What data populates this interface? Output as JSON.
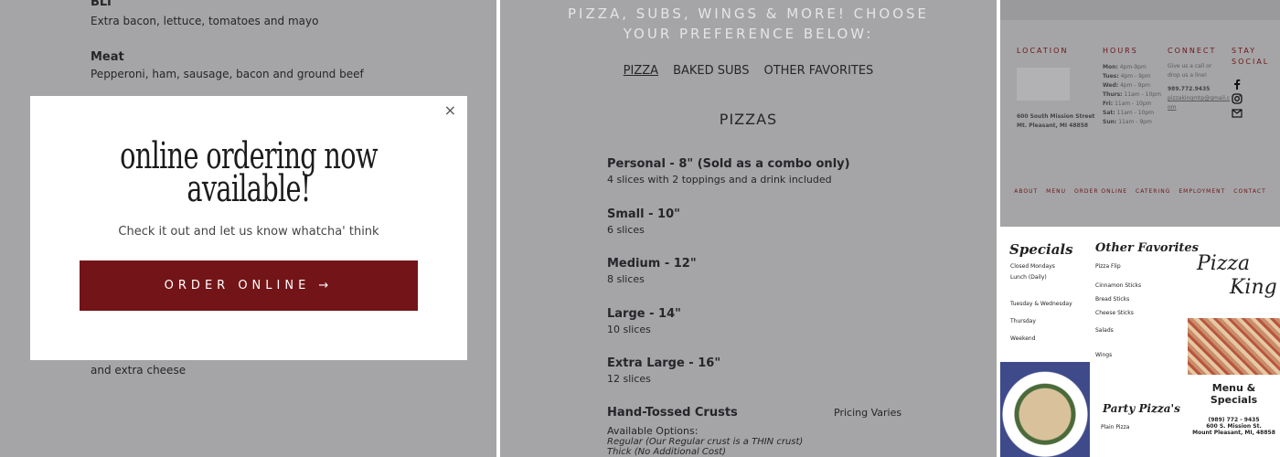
{
  "left": {
    "items": [
      {
        "title": "BLT",
        "desc": "Extra bacon, lettuce, tomatoes and mayo"
      },
      {
        "title": "Meat",
        "desc": "Pepperoni, ham, sausage, bacon and ground beef"
      }
    ],
    "hidden_fragment_1": "and extra cheese",
    "modal": {
      "close": "×",
      "headline_line1": "online ordering now",
      "headline_line2": "available!",
      "subtext": "Check it out and let us know whatcha' think",
      "button": "ORDER ONLINE →"
    }
  },
  "middle": {
    "heading_line1": "PIZZA, SUBS, WINGS & MORE! CHOOSE",
    "heading_line2": "YOUR PREFERENCE BELOW:",
    "tabs": [
      "PIZZA",
      "BAKED SUBS",
      "OTHER FAVORITES"
    ],
    "section_title": "PIZZAS",
    "items": [
      {
        "title": "Personal - 8\" (Sold as a combo only)",
        "desc": "4 slices with 2 toppings and a drink included"
      },
      {
        "title": "Small - 10\"",
        "desc": "6 slices"
      },
      {
        "title": "Medium - 12\"",
        "desc": "8 slices"
      },
      {
        "title": "Large - 14\"",
        "desc": "10 slices"
      },
      {
        "title": "Extra Large - 16\"",
        "desc": "12 slices"
      }
    ],
    "crusts": {
      "title": "Hand-Tossed Crusts",
      "price": "Pricing Varies",
      "available": "Available Options:",
      "regular": "Regular (Our Regular crust is a THIN crust)",
      "thick": "Thick (No Additional Cost)"
    }
  },
  "footer": {
    "location_h": "LOCATION",
    "address1": "600 South Mission Street",
    "address2": "Mt. Pleasant, MI 48858",
    "hours_h": "HOURS",
    "hours": [
      {
        "day": "Mon:",
        "time": "4pm-9pm"
      },
      {
        "day": "Tues:",
        "time": "4pm - 9pm"
      },
      {
        "day": "Wed:",
        "time": "4pm - 9pm"
      },
      {
        "day": "Thurs:",
        "time": "11am - 10pm"
      },
      {
        "day": "Fri:",
        "time": "11am - 10pm"
      },
      {
        "day": "Sat:",
        "time": "11am - 10pm"
      },
      {
        "day": "Sun:",
        "time": "11am - 9pm"
      }
    ],
    "connect_h": "CONNECT",
    "connect_text": "Give us a call or drop us a line!",
    "phone": "989.772.9435",
    "email1": "pizzakingmtp@gmail.c",
    "email2": "om",
    "social_h1": "STAY",
    "social_h2": "SOCIAL",
    "links": [
      "ABOUT",
      "MENU",
      "ORDER ONLINE",
      "CATERING",
      "EMPLOYMENT",
      "CONTACT"
    ]
  },
  "flyer": {
    "specials_h": "Specials",
    "specials": [
      "Closed Mondays",
      "Lunch (Daily)",
      "Tuesday & Wednesday",
      "Thursday",
      "Weekend"
    ],
    "other_h": "Other Favorites",
    "other": [
      "Pizza Flip",
      "Cinnamon Sticks",
      "Bread Sticks",
      "Cheese Sticks",
      "Salads",
      "Wings"
    ],
    "party_h": "Party Pizza's",
    "party_item": "Plain Pizza",
    "logo1": "Pizza",
    "logo2": "King",
    "menu_title": "Menu & Specials",
    "phone": "(989) 772 - 9435",
    "addr1": "600 S. Mission St.",
    "addr2": "Mount Pleasant, MI, 48858"
  },
  "colors": {
    "accent": "#731518",
    "panel": "#a5a5a7"
  }
}
